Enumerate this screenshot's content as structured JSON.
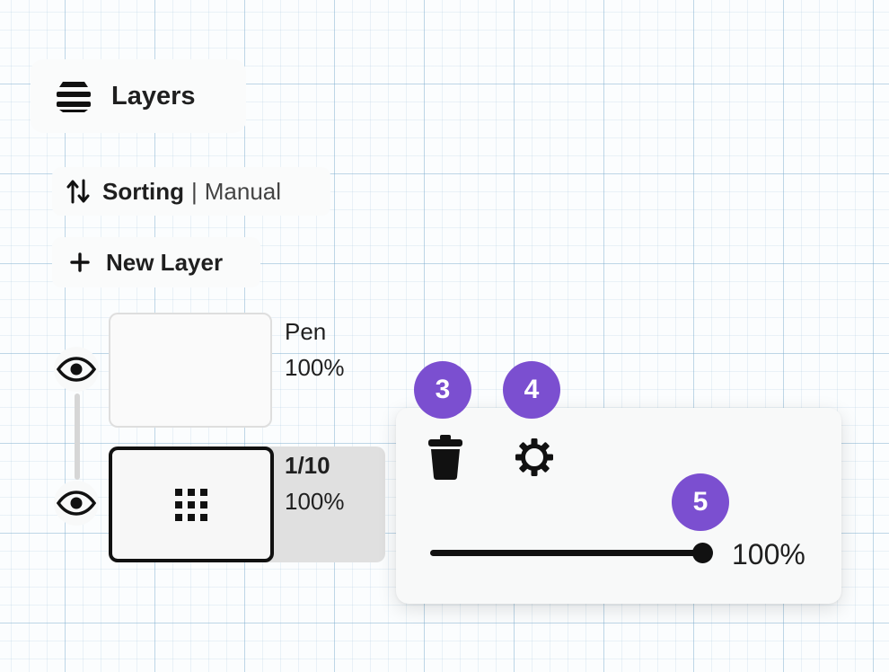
{
  "header": {
    "title": "Layers",
    "icon": "layers-icon"
  },
  "sorting": {
    "label": "Sorting",
    "separator": "|",
    "value": "Manual",
    "icon": "sort-arrows-icon"
  },
  "new_layer": {
    "label": "New Layer",
    "icon": "plus-icon"
  },
  "layers": [
    {
      "name": "Pen",
      "opacity": "100%",
      "visible": true,
      "selected": false
    },
    {
      "name": "1/10",
      "opacity": "100%",
      "visible": true,
      "selected": true,
      "thumb_icon": "dot-grid-icon"
    }
  ],
  "popup": {
    "delete_icon": "trash-icon",
    "settings_icon": "gear-icon",
    "opacity_label": "100%",
    "opacity_fraction": 1.0
  },
  "badges": [
    "3",
    "4",
    "5"
  ],
  "colors": {
    "badge": "#7b4fd0",
    "selected_row": "#e0e0e0",
    "ink": "#111111"
  }
}
